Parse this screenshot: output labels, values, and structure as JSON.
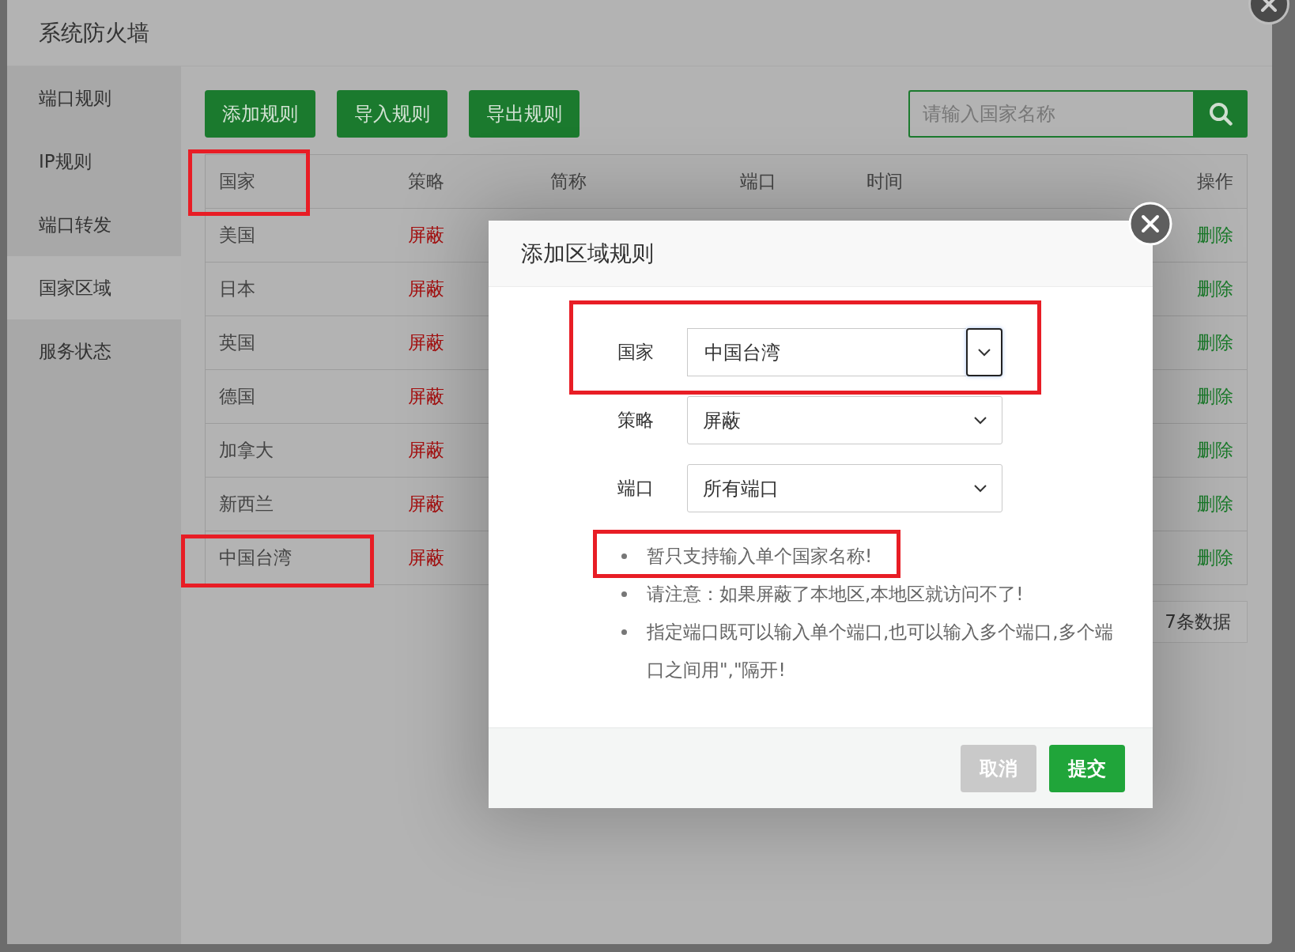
{
  "window": {
    "title": "系统防火墙"
  },
  "sidebar": {
    "items": [
      {
        "label": "端口规则",
        "selected": false
      },
      {
        "label": "IP规则",
        "selected": false
      },
      {
        "label": "端口转发",
        "selected": false
      },
      {
        "label": "国家区域",
        "selected": true
      },
      {
        "label": "服务状态",
        "selected": false
      }
    ]
  },
  "toolbar": {
    "buttons": [
      "添加规则",
      "导入规则",
      "导出规则"
    ],
    "search": {
      "placeholder": "请输入国家名称"
    }
  },
  "table": {
    "columns": [
      {
        "label": "国家",
        "highlighted": true
      },
      {
        "label": "策略",
        "highlighted": false
      },
      {
        "label": "简称",
        "highlighted": false
      },
      {
        "label": "端口",
        "highlighted": false
      },
      {
        "label": "时间",
        "highlighted": false
      },
      {
        "label": "操作",
        "highlighted": false
      }
    ],
    "rows": [
      {
        "country": "美国",
        "policy": "屏蔽",
        "action": "删除",
        "highlighted": false
      },
      {
        "country": "日本",
        "policy": "屏蔽",
        "action": "删除",
        "highlighted": false
      },
      {
        "country": "英国",
        "policy": "屏蔽",
        "action": "删除",
        "highlighted": false
      },
      {
        "country": "德国",
        "policy": "屏蔽",
        "action": "删除",
        "highlighted": false
      },
      {
        "country": "加拿大",
        "policy": "屏蔽",
        "action": "删除",
        "highlighted": false
      },
      {
        "country": "新西兰",
        "policy": "屏蔽",
        "action": "删除",
        "highlighted": false
      },
      {
        "country": "中国台湾",
        "policy": "屏蔽",
        "action": "删除",
        "highlighted": true
      }
    ]
  },
  "pagination": {
    "summary": "7条数据"
  },
  "dialog": {
    "title": "添加区域规则",
    "fields": [
      {
        "kind": "combo",
        "label": "国家",
        "value": "中国台湾",
        "highlighted": true
      },
      {
        "kind": "select",
        "label": "策略",
        "value": "屏蔽",
        "highlighted": false
      },
      {
        "kind": "select",
        "label": "端口",
        "value": "所有端口",
        "highlighted": false
      }
    ],
    "tips": [
      {
        "text": "暂只支持输入单个国家名称!",
        "highlighted": true
      },
      {
        "text": "请注意：如果屏蔽了本地区,本地区就访问不了!",
        "highlighted": false
      },
      {
        "text": "指定端口既可以输入单个端口,也可以输入多个端口,多个端口之间用\",\"隔开!",
        "highlighted": false
      }
    ],
    "buttons": [
      {
        "label": "取消",
        "kind": "secondary"
      },
      {
        "label": "提交",
        "kind": "primary"
      }
    ]
  }
}
